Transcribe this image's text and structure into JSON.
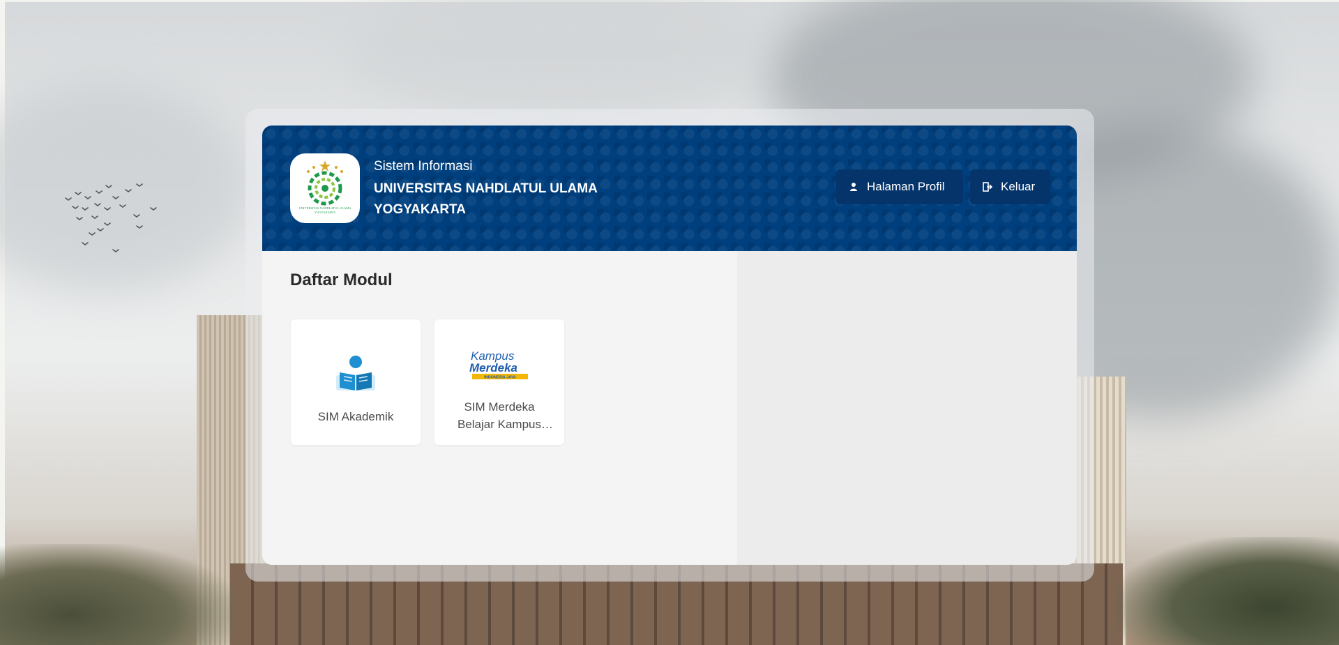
{
  "header": {
    "subtitle": "Sistem Informasi",
    "title": "UNIVERSITAS NAHDLATUL ULAMA YOGYAKARTA",
    "profile_button": "Halaman Profil",
    "logout_button": "Keluar"
  },
  "logo": {
    "text_line1": "UNIVERSITAS NAHDLATUL ULAMA",
    "text_line2": "YOGYAKARTA"
  },
  "modules": {
    "title": "Daftar Modul",
    "items": [
      {
        "label": "SIM Akademik",
        "icon": "reading-person-icon"
      },
      {
        "label": "SIM Merdeka Belajar Kampus Merdeka",
        "icon": "kampus-merdeka-logo"
      }
    ]
  },
  "kampus_logo": {
    "line1": "Kampus",
    "line2": "Merdeka",
    "tagline": "INDONESIA JAYA"
  },
  "colors": {
    "header_bg": "#003f7d",
    "button_bg": "#05346a",
    "logo_green": "#1f9a4c",
    "logo_gold": "#d9a726",
    "icon_blue": "#1e8fd0"
  }
}
